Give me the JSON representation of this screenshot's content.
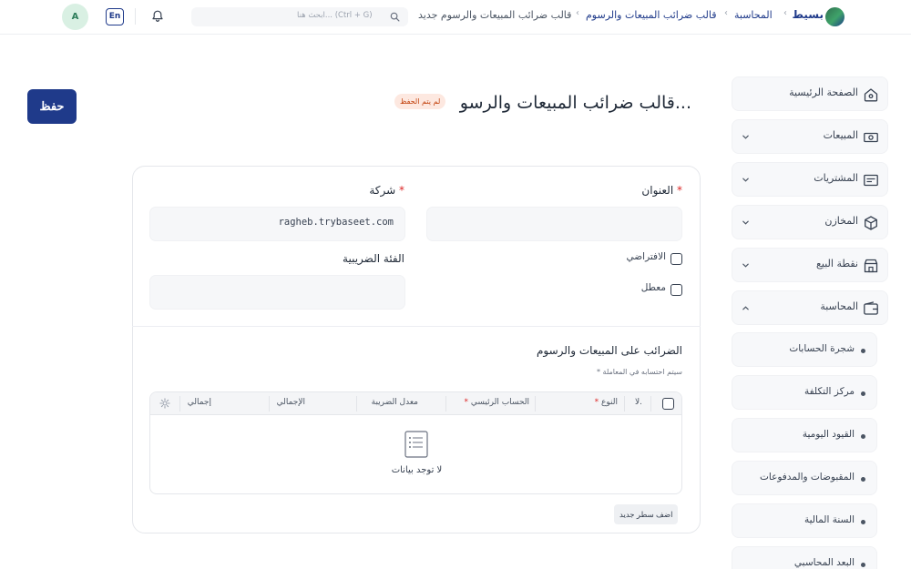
{
  "header": {
    "logo_text": "بسيط",
    "breadcrumbs": [
      "المحاسبة",
      "قالب ضرائب المبيعات والرسوم",
      "قالب ضرائب المبيعات والرسوم جديد"
    ],
    "search_placeholder": "ابحث هنا... (Ctrl + G)",
    "lang_label": "En",
    "avatar_initial": "A"
  },
  "sidebar": {
    "items": [
      {
        "label": "الصفحة الرئيسية",
        "icon": "home-icon"
      },
      {
        "label": "المبيعات",
        "icon": "money-icon"
      },
      {
        "label": "المشتريات",
        "icon": "receipt-icon"
      },
      {
        "label": "المخازن",
        "icon": "box-icon"
      },
      {
        "label": "نقطة البيع",
        "icon": "store-icon"
      },
      {
        "label": "المحاسبة",
        "icon": "wallet-icon"
      }
    ],
    "sub_items": [
      "شجرة الحسابات",
      "مركز التكلفة",
      "القيود اليومية",
      "المقبوضات والمدفوعات",
      "السنة المالية",
      "البعد المحاسبي"
    ]
  },
  "page": {
    "title": "قالب ضرائب المبيعات والرسو...",
    "status_badge": "لم يتم الحفظ",
    "save_label": "حفظ"
  },
  "form": {
    "title_label": "العنوان",
    "title_value": "",
    "company_label": "شركة",
    "company_value": "ragheb.trybaseet.com",
    "default_label": "الافتراضي",
    "disabled_label": "معطل",
    "tax_category_label": "الفئة الضريبية",
    "tax_category_value": ""
  },
  "taxes": {
    "section_title": "الضرائب على المبيعات والرسوم",
    "note": "* سيتم احتسابه في المعاملة",
    "columns": [
      "لا.",
      "النوع",
      "الحساب الرئيسي",
      "معدل الضريبة",
      "الإجمالي",
      "إجمالي"
    ],
    "empty_text": "لا توجد بيانات",
    "add_row_label": "اضف سطر جديد"
  },
  "colors": {
    "brand": "#1f3a8a",
    "badge_bg": "#fde8e0",
    "badge_text": "#c2410c"
  }
}
